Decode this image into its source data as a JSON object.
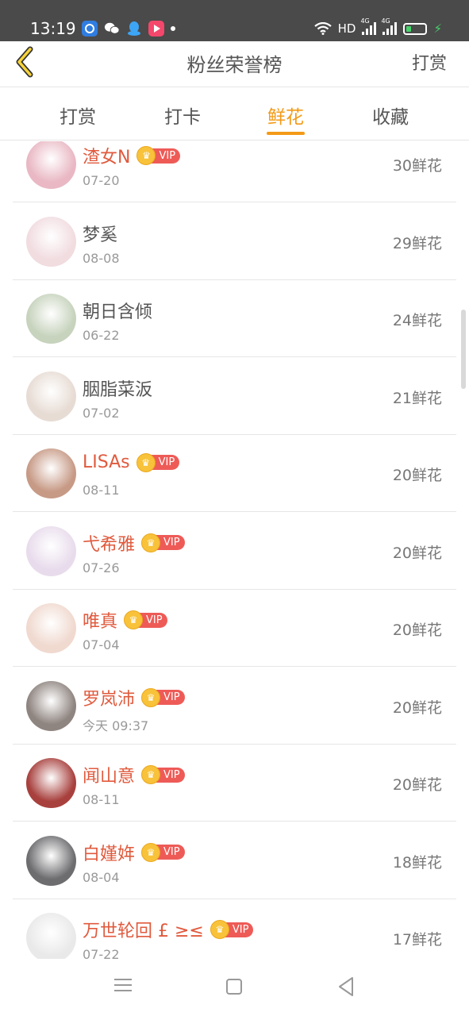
{
  "status_bar": {
    "time": "13:19",
    "network_label": "HD",
    "signal1_label": "4G",
    "signal2_label": "4G"
  },
  "header": {
    "title": "粉丝荣誉榜",
    "action": "打赏"
  },
  "tabs": [
    {
      "label": "打赏",
      "active": false
    },
    {
      "label": "打卡",
      "active": false
    },
    {
      "label": "鲜花",
      "active": true
    },
    {
      "label": "收藏",
      "active": false
    }
  ],
  "vip_label": "VIP",
  "fans": [
    {
      "name": "渣女N",
      "date": "07-20",
      "count": "30鲜花",
      "vip": true,
      "avatar_color": "#e9b8c4"
    },
    {
      "name": "梦奚",
      "date": "08-08",
      "count": "29鲜花",
      "vip": false,
      "avatar_color": "#f1dce0"
    },
    {
      "name": "朝日含倾",
      "date": "06-22",
      "count": "24鲜花",
      "vip": false,
      "avatar_color": "#c7d3bd"
    },
    {
      "name": "胭脂菜汳",
      "date": "07-02",
      "count": "21鲜花",
      "vip": false,
      "avatar_color": "#e7dcd4"
    },
    {
      "name": "LISAs",
      "date": "08-11",
      "count": "20鲜花",
      "vip": true,
      "avatar_color": "#c79a86"
    },
    {
      "name": "弋希雅",
      "date": "07-26",
      "count": "20鲜花",
      "vip": true,
      "avatar_color": "#e8dcec"
    },
    {
      "name": "唯真",
      "date": "07-04",
      "count": "20鲜花",
      "vip": true,
      "avatar_color": "#f0d9cf"
    },
    {
      "name": "罗岚沛",
      "date": "今天 09:37",
      "count": "20鲜花",
      "vip": true,
      "avatar_color": "#8f8580"
    },
    {
      "name": "闻山意",
      "date": "08-11",
      "count": "20鲜花",
      "vip": true,
      "avatar_color": "#a8413e"
    },
    {
      "name": "白嫤姩",
      "date": "08-04",
      "count": "18鲜花",
      "vip": true,
      "avatar_color": "#6d6d70"
    },
    {
      "name": "万世轮回 £ ≥≤",
      "date": "07-22",
      "count": "17鲜花",
      "vip": true,
      "avatar_color": "#e9e9e9"
    }
  ]
}
